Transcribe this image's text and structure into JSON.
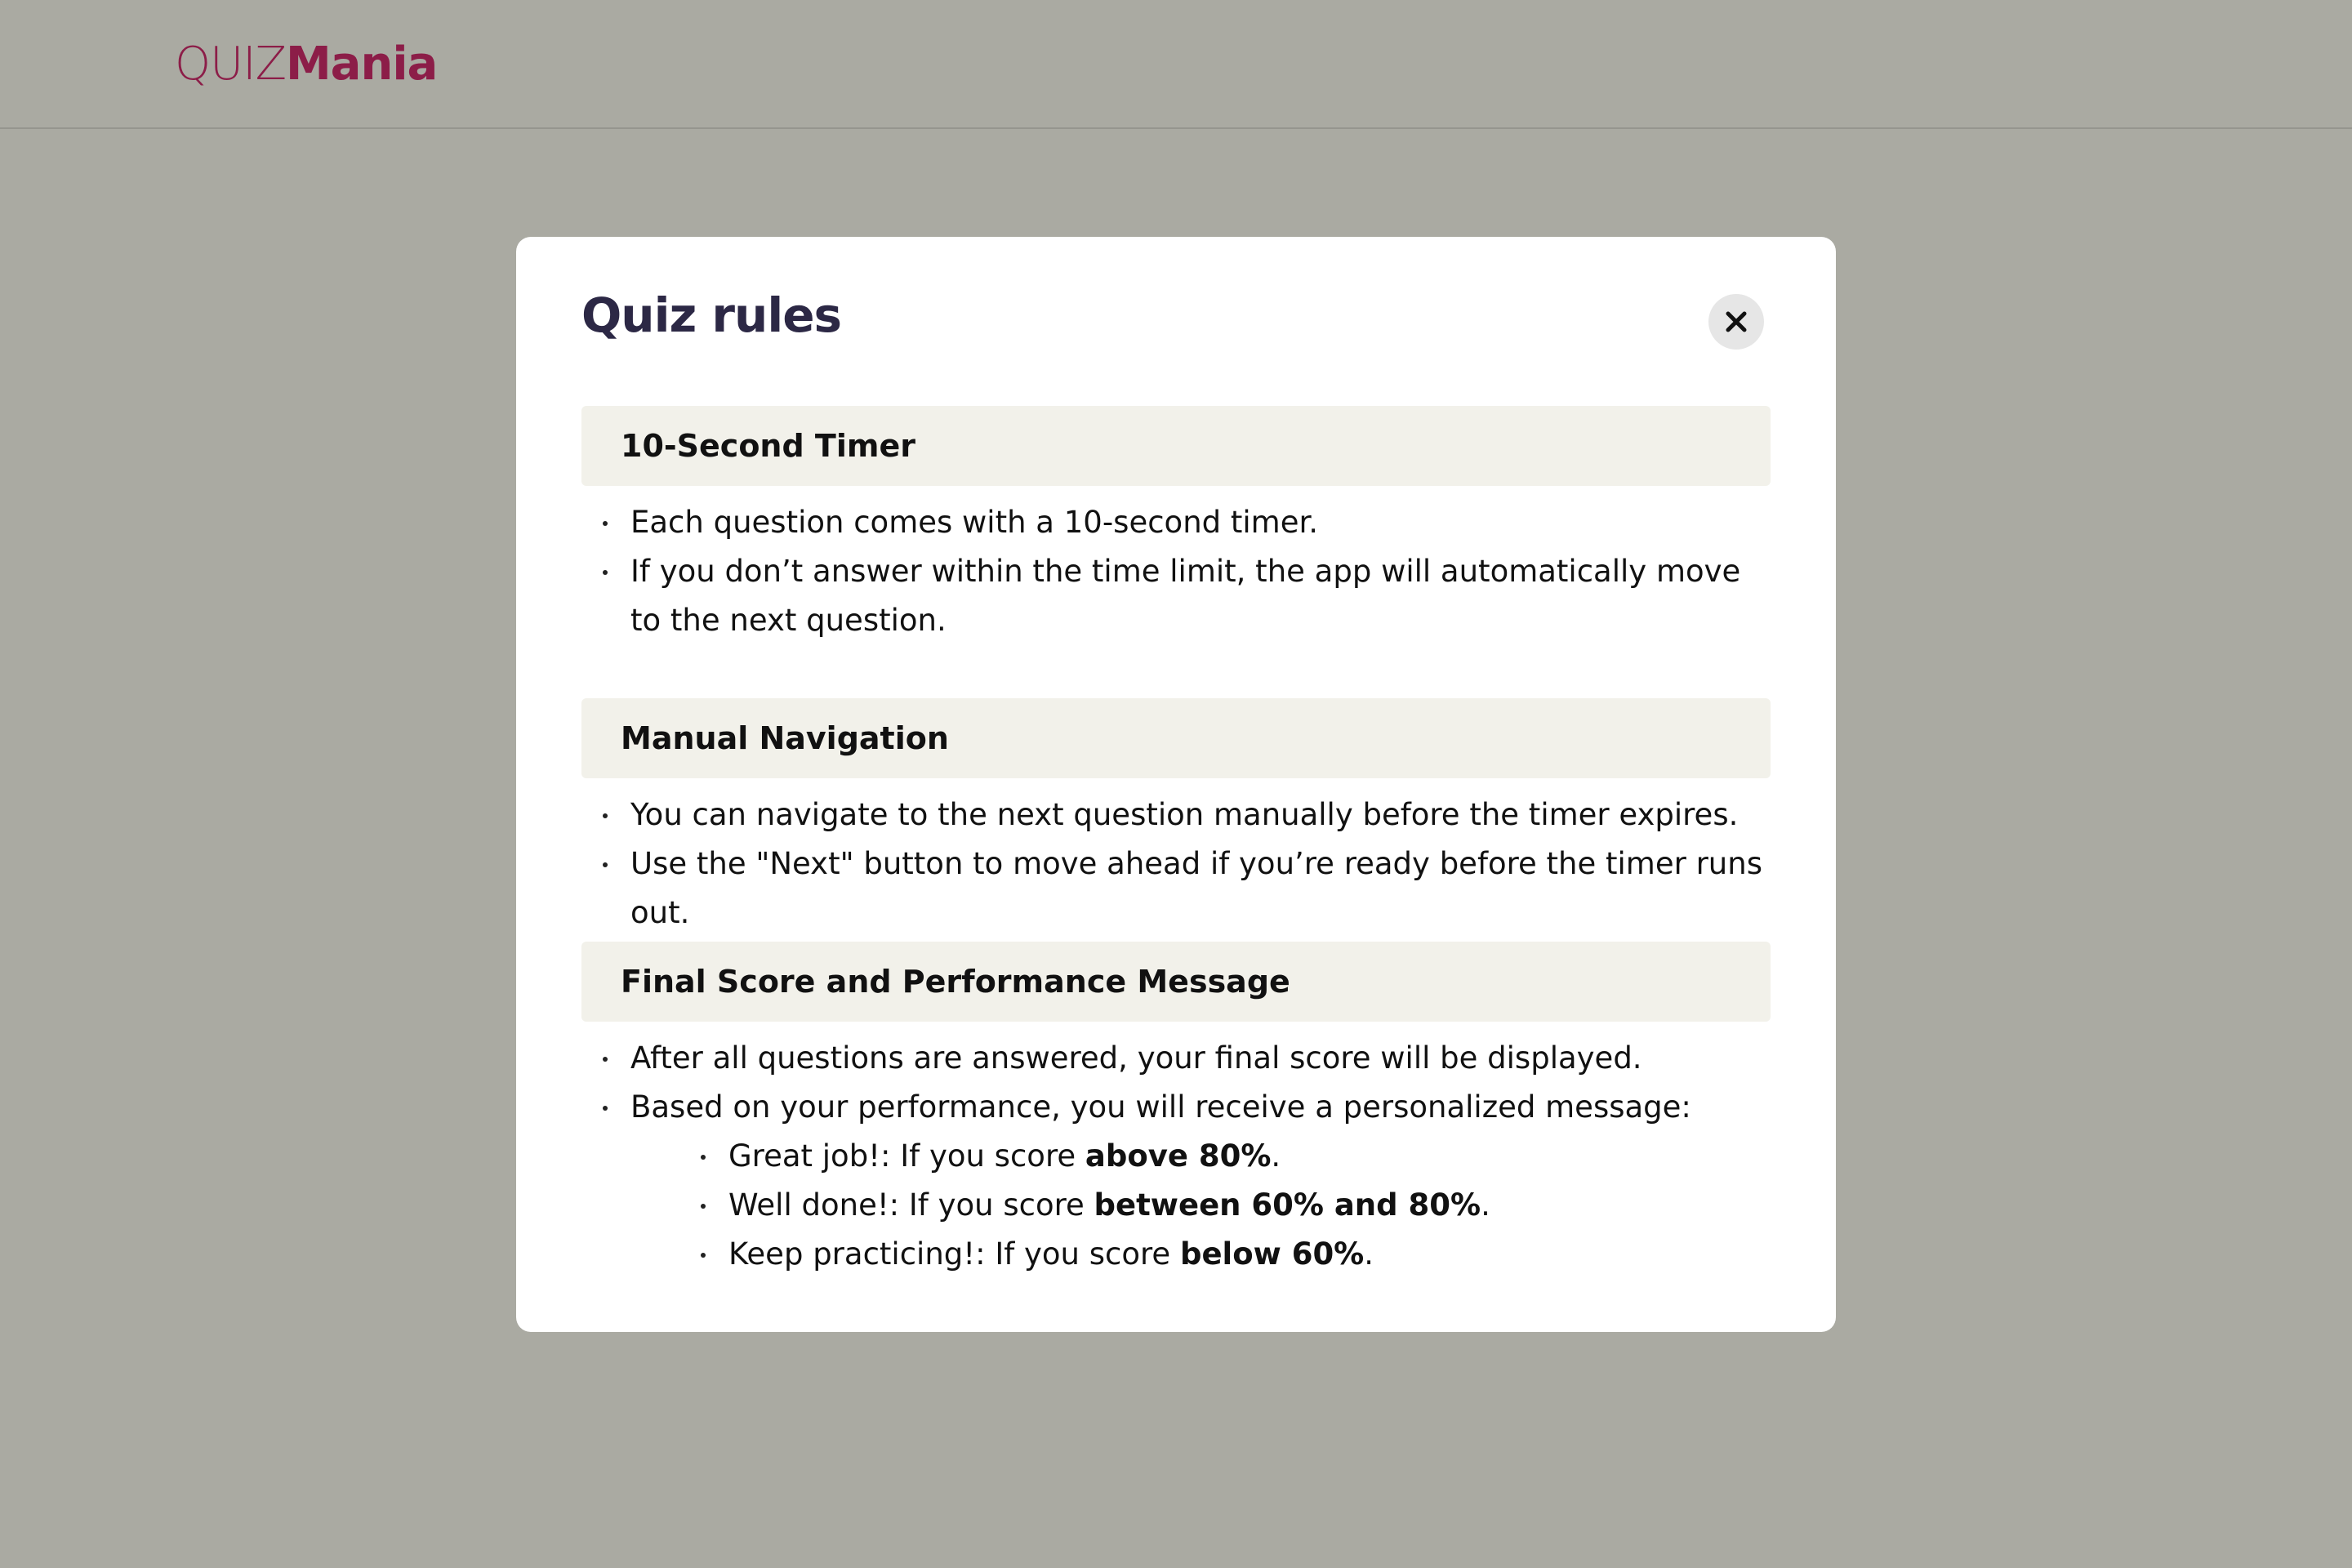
{
  "header": {
    "logo_light": "QUIZ",
    "logo_bold": "Mania"
  },
  "modal": {
    "title": "Quiz rules",
    "close_icon": "close-icon",
    "sections": [
      {
        "heading": "10-Second Timer",
        "items": [
          "Each question comes with a 10-second timer.",
          "If you don’t answer within the time limit, the app will automatically move to the next question."
        ]
      },
      {
        "heading": "Manual Navigation",
        "items": [
          "You can navigate to the next question manually before the timer expires.",
          "Use the \"Next\" button to move ahead if you’re ready before the timer runs out."
        ]
      },
      {
        "heading": "Final Score and Performance Message",
        "items": [
          "After all questions are answered, your final score will be displayed.",
          "Based on your performance, you will receive a personalized message:"
        ],
        "messages": [
          {
            "prefix": "Great job!: If you score ",
            "emphasis": "above 80%",
            "suffix": "."
          },
          {
            "prefix": "Well done!: If you score ",
            "emphasis": "between 60% and 80%",
            "suffix": "."
          },
          {
            "prefix": "Keep practicing!: If you score ",
            "emphasis": "below 60%",
            "suffix": "."
          }
        ]
      }
    ]
  },
  "colors": {
    "backdrop": "#aaaaa2",
    "brand": "#8c1d48",
    "title": "#2c2845",
    "section_bg": "#f2f1ea",
    "close_bg": "#e6e6e6"
  }
}
